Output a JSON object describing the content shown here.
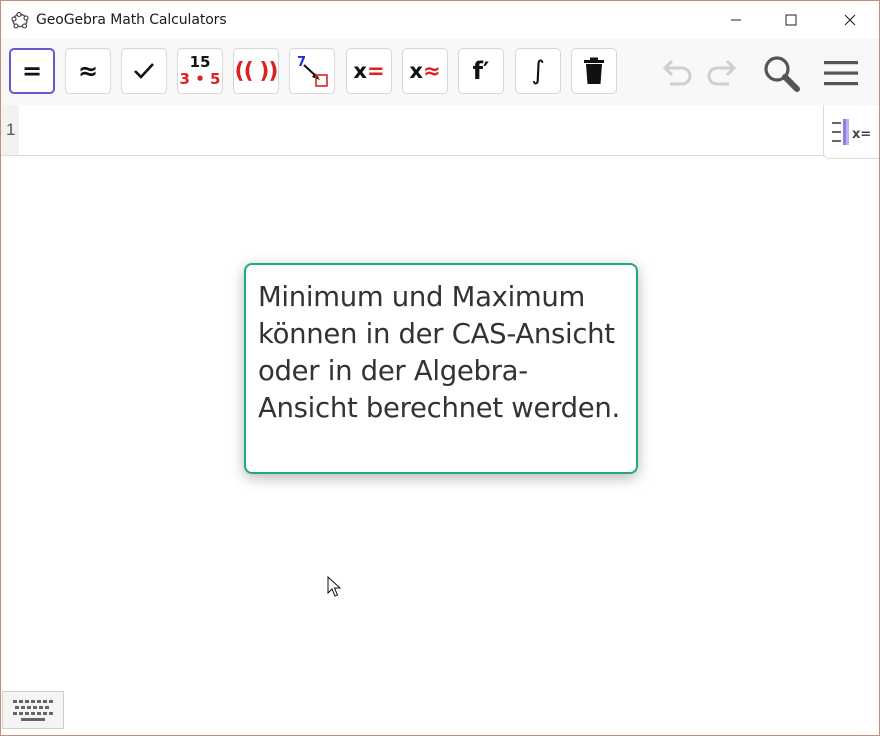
{
  "window": {
    "title": "GeoGebra Math Calculators"
  },
  "toolbar": {
    "buttons": [
      {
        "name": "evaluate",
        "symbol": "="
      },
      {
        "name": "numeric",
        "symbol": "≈"
      },
      {
        "name": "keep-input",
        "symbol": "✓"
      },
      {
        "name": "factor",
        "symbol_top": "15",
        "symbol_bottom": "3 • 5"
      },
      {
        "name": "expand",
        "symbol": "(( ))"
      },
      {
        "name": "substitute",
        "symbol": "7"
      },
      {
        "name": "solve",
        "symbol": "x="
      },
      {
        "name": "solve-numerically",
        "symbol": "x≈"
      },
      {
        "name": "derivative",
        "symbol": "f′"
      },
      {
        "name": "integral",
        "symbol": "∫"
      },
      {
        "name": "delete",
        "icon": "trash-icon"
      }
    ]
  },
  "cas": {
    "row_number": "1",
    "input_value": "",
    "view_toggle_label": "x="
  },
  "tooltip": {
    "text": "Minimum und Maximum können in der CAS-Ansicht oder in der Algebra-Ansicht berechnet werden."
  },
  "colors": {
    "accent": "#6557d2",
    "tooltip_border": "#1ea886",
    "red": "#e0201f",
    "blue": "#1f2fd6"
  }
}
